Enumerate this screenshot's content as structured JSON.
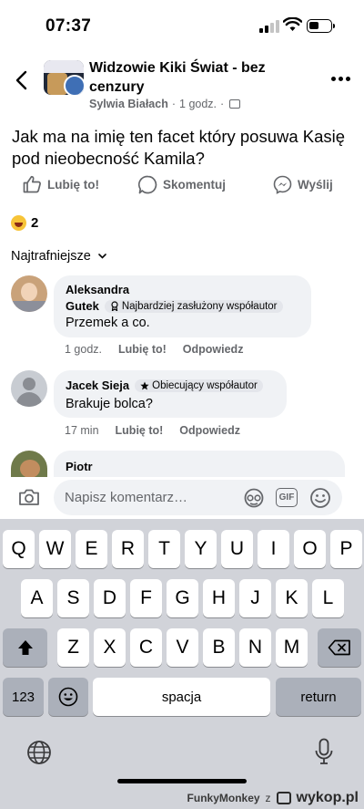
{
  "status_bar": {
    "time": "07:37"
  },
  "header": {
    "group_name": "Widzowie Kiki Świat - bez cenzury",
    "author": "Sylwia Białach",
    "separator": "·",
    "time": "1 godz.",
    "separator2": "·"
  },
  "post": {
    "text": "Jak ma na imię ten facet który posuwa Kasię pod nieobecność Kamila?"
  },
  "actions": {
    "like": "Lubię to!",
    "comment": "Skomentuj",
    "send": "Wyślij"
  },
  "reactions": {
    "count": "2"
  },
  "sort": {
    "label": "Najtrafniejsze"
  },
  "comments": [
    {
      "name_line1": "Aleksandra",
      "name_line2": "Gutek",
      "badge": "Najbardziej zasłużony współautor",
      "text": "Przemek a co.",
      "time": "1 godz.",
      "like": "Lubię to!",
      "reply": "Odpowiedz"
    },
    {
      "name": "Jacek Sieja",
      "badge": "Obiecujący współautor",
      "text": "Brakuje bolca?",
      "time": "17 min",
      "like": "Lubię to!",
      "reply": "Odpowiedz"
    },
    {
      "name": "Piotr"
    }
  ],
  "composer": {
    "placeholder": "Napisz komentarz…",
    "gif": "GIF"
  },
  "keyboard": {
    "row1": [
      "Q",
      "W",
      "E",
      "R",
      "T",
      "Y",
      "U",
      "I",
      "O",
      "P"
    ],
    "row2": [
      "A",
      "S",
      "D",
      "F",
      "G",
      "H",
      "J",
      "K",
      "L"
    ],
    "row3": [
      "Z",
      "X",
      "C",
      "V",
      "B",
      "N",
      "M"
    ],
    "numbers": "123",
    "space": "spacja",
    "return": "return"
  },
  "watermark": {
    "user": "FunkyMonkey",
    "sep": "z",
    "site": "wykop.pl"
  },
  "colors": {
    "secondary_text": "#65676b",
    "bubble": "#f0f2f5",
    "keyboard_bg": "#d1d3d9"
  }
}
